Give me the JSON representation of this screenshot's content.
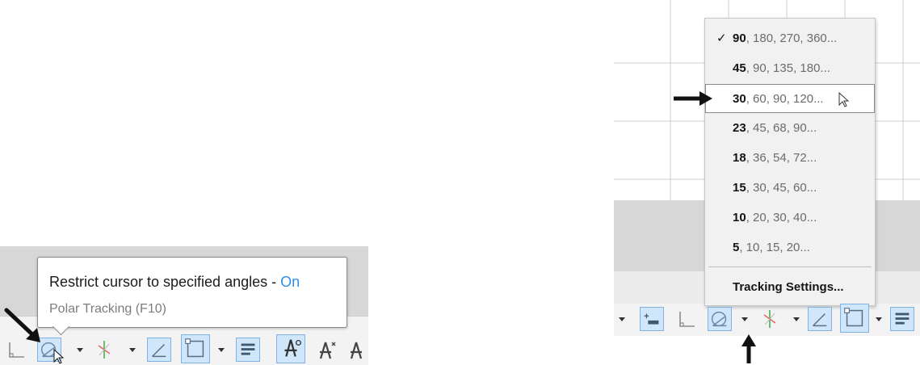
{
  "left_panel": {
    "tooltip": {
      "title": "Restrict cursor to specified angles - ",
      "state": "On",
      "subtitle": "Polar Tracking (F10)"
    },
    "toolbar_icons": [
      "ortho-icon",
      "polar-tracking-icon",
      "dropdown-arrow",
      "isodraft-icon",
      "dropdown-arrow",
      "object-snap-tracking-icon",
      "object-snap-icon",
      "dropdown-arrow",
      "lineweight-icon",
      "annotation-scale-icon",
      "annotation-autoscale-icon",
      "annotation-visibility-icon"
    ]
  },
  "right_panel": {
    "polar_menu": {
      "items": [
        {
          "lead": "90",
          "rest": ", 180, 270, 360...",
          "checked": true
        },
        {
          "lead": "45",
          "rest": ", 90, 135, 180...",
          "checked": false
        },
        {
          "lead": "30",
          "rest": ", 60, 90, 120...",
          "checked": false,
          "hover": true
        },
        {
          "lead": "23",
          "rest": ", 45, 68, 90...",
          "checked": false
        },
        {
          "lead": "18",
          "rest": ", 36, 54, 72...",
          "checked": false
        },
        {
          "lead": "15",
          "rest": ", 30, 45, 60...",
          "checked": false
        },
        {
          "lead": "10",
          "rest": ", 20, 30, 40...",
          "checked": false
        },
        {
          "lead": "5",
          "rest": ", 10, 15, 20...",
          "checked": false
        }
      ],
      "settings_label": "Tracking Settings...",
      "check_mark": "✓"
    },
    "toolbar_icons": [
      "dropdown-arrow",
      "dynamic-input-icon",
      "ortho-icon",
      "polar-tracking-icon",
      "dropdown-arrow",
      "isodraft-icon",
      "dropdown-arrow",
      "object-snap-tracking-icon",
      "object-snap-icon",
      "dropdown-arrow",
      "lineweight-icon"
    ]
  },
  "colors": {
    "accent": "#2e8fe6",
    "active_button_bg": "#cfe6fb",
    "menu_bg": "#f1f1f1",
    "status_bar_bg": "#f3f3f3"
  }
}
